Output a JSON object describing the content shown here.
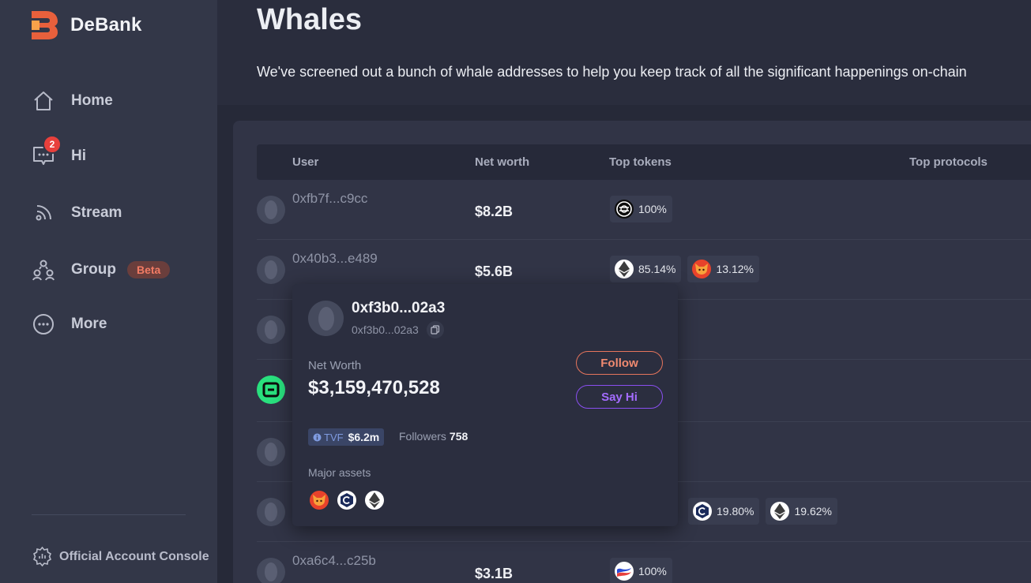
{
  "brand": {
    "name": "DeBank"
  },
  "sidebar": {
    "items": [
      {
        "label": "Home",
        "icon": "home-icon"
      },
      {
        "label": "Hi",
        "icon": "chat-icon",
        "badge": "2"
      },
      {
        "label": "Stream",
        "icon": "rss-icon"
      },
      {
        "label": "Group",
        "icon": "group-icon",
        "tag": "Beta"
      },
      {
        "label": "More",
        "icon": "more-icon"
      }
    ],
    "console": {
      "label": "Official Account Console",
      "icon": "console-icon"
    }
  },
  "header": {
    "title": "Whales",
    "description": "We've screened out a bunch of whale addresses to help you keep track of all the significant happenings on-chain"
  },
  "table": {
    "columns": [
      "User",
      "Net worth",
      "Top tokens",
      "Top protocols"
    ],
    "rows": [
      {
        "address": "0xfb7f...c9cc",
        "net_worth": "$8.2B",
        "tokens": [
          {
            "icon": "wormhole-token-icon",
            "pct": "100%"
          }
        ]
      },
      {
        "address": "0x40b3...e489",
        "net_worth": "$5.6B",
        "tokens": [
          {
            "icon": "eth-token-icon",
            "pct": "85.14%"
          },
          {
            "icon": "shib-token-icon",
            "pct": "13.12%"
          }
        ]
      },
      {
        "address": "",
        "net_worth": "",
        "tokens": []
      },
      {
        "address": "",
        "net_worth": "",
        "tokens": []
      },
      {
        "address": "",
        "net_worth": "",
        "tokens": []
      },
      {
        "address": "",
        "net_worth": "",
        "tokens": [
          {
            "icon": "crypto-com-token-icon",
            "pct": "19.80%"
          },
          {
            "icon": "eth-token-icon",
            "pct": "19.62%"
          }
        ]
      },
      {
        "address": "0xa6c4...c25b",
        "net_worth": "$3.1B",
        "tokens": [
          {
            "icon": "lido-token-icon",
            "pct": "100%"
          }
        ]
      }
    ]
  },
  "popup": {
    "name": "0xf3b0...02a3",
    "sub_address": "0xf3b0...02a3",
    "net_worth_label": "Net Worth",
    "net_worth_value": "$3,159,470,528",
    "follow_label": "Follow",
    "sayhi_label": "Say Hi",
    "tvf_label": "TVF",
    "tvf_value": "$6.2m",
    "followers_label": "Followers",
    "followers_value": "758",
    "major_assets_label": "Major assets",
    "major_assets": [
      "shib-token-icon",
      "crypto-com-token-icon",
      "eth-token-icon"
    ]
  },
  "colors": {
    "accent_orange": "#f08a70",
    "accent_purple": "#a46cff",
    "badge_red": "#e8403c",
    "brand_orange": "#e8603c"
  }
}
